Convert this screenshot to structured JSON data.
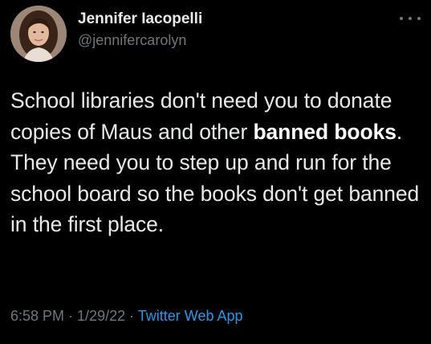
{
  "tweet": {
    "author": {
      "display_name": "Jennifer Iacopelli",
      "handle": "@jennifercarolyn",
      "avatar_icon": "user-avatar-photo"
    },
    "more_icon": "more-options-icon",
    "text_parts": {
      "before_bold": "School libraries don't need you to donate copies of Maus and other ",
      "bold": "banned books",
      "after_bold": ". They need you to step up and run for the school board so the books don't get banned in the first place."
    },
    "time": "6:58 PM",
    "separator": " · ",
    "date": "1/29/22",
    "source": "Twitter Web App"
  },
  "colors": {
    "background": "#000000",
    "text": "#e7e9ea",
    "secondary": "#71767b",
    "link": "#1d9bf0"
  }
}
